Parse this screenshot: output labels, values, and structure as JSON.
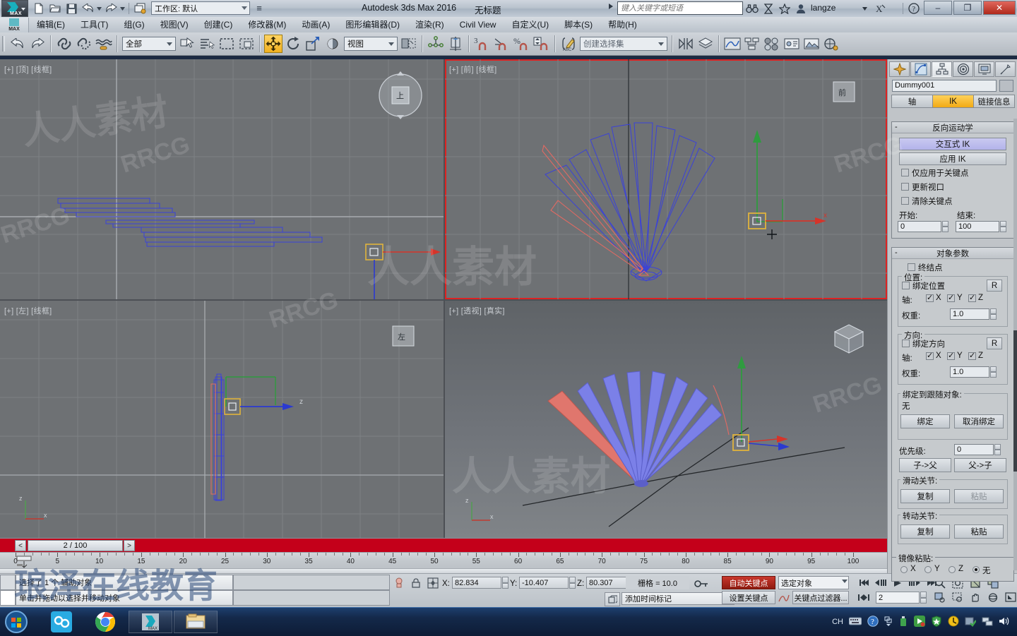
{
  "titlebar": {
    "app_title": "Autodesk 3ds Max 2016",
    "doc_title": "无标题",
    "workspace_label": "工作区: 默认",
    "search_placeholder": "键入关键字或短语",
    "user": "langze",
    "max_caption": "MAX",
    "minimize": "–",
    "restore": "❐",
    "close": "✕"
  },
  "menu": {
    "max_caption": "MAX",
    "items": [
      "编辑(E)",
      "工具(T)",
      "组(G)",
      "视图(V)",
      "创建(C)",
      "修改器(M)",
      "动画(A)",
      "图形编辑器(D)",
      "渲染(R)",
      "Civil View",
      "自定义(U)",
      "脚本(S)",
      "帮助(H)"
    ]
  },
  "toolbar": {
    "selection_filter": "全部",
    "ref_coord_system": "视图",
    "named_selection_sets": "创建选择集",
    "icons": [
      "undo-icon",
      "redo-icon",
      "select-link-icon",
      "unlink-icon",
      "bind-spacewarp-icon",
      "select-object-icon",
      "select-by-name-icon",
      "rect-select-region-icon",
      "window-crossing-icon",
      "select-and-move-icon",
      "select-and-rotate-icon",
      "select-and-scale-icon",
      "snap-toggle-icon",
      "angle-snap-icon",
      "percent-snap-icon",
      "spinner-snap-icon",
      "mirror-icon",
      "align-icon",
      "layer-manager-icon",
      "curve-editor-icon",
      "schematic-view-icon",
      "material-editor-icon",
      "render-setup-icon",
      "render-frame-icon",
      "render-production-icon"
    ]
  },
  "viewports": [
    {
      "id": "top",
      "label": "[+] [顶] [线框]"
    },
    {
      "id": "front",
      "label": "[+] [前] [线框]",
      "active": true
    },
    {
      "id": "left",
      "label": "[+] [左] [线框]"
    },
    {
      "id": "persp",
      "label": "[+] [透视] [真实]"
    }
  ],
  "viewcube": {
    "top": "上",
    "front": "前",
    "left": "左"
  },
  "axis_tripod": {
    "x": "x",
    "y": "y",
    "z": "z"
  },
  "timeslider": {
    "current": "2 / 100",
    "prev": "<",
    "next": ">"
  },
  "trackbar": {
    "ticks": [
      0,
      5,
      10,
      15,
      20,
      25,
      30,
      35,
      40,
      45,
      50,
      55,
      60,
      65,
      70,
      75,
      80,
      85,
      90,
      95,
      100
    ]
  },
  "statusbar": {
    "prompt_selection": "选择了 1 个 辅助对象",
    "prompt_hint": "单击并拖动以选择并移动对象",
    "isolate_icon": "isolate-selection-icon",
    "lock_icon": "selection-lock-icon",
    "coords": {
      "x_label": "X:",
      "x": "82.834",
      "y_label": "Y:",
      "y": "-10.407",
      "z_label": "Z:",
      "z": "80.307"
    },
    "grid": "栅格 = 10.0",
    "add_time_tag": "添加时间标记",
    "key_mode_icon": "key-mode-icon"
  },
  "animation": {
    "auto_key": "自动关键点",
    "set_key": "设置关键点",
    "key_filters": "关键点过滤器...",
    "selection_list": "选定对象",
    "curve_icon": "set-key-curve-icon",
    "current_frame": "2",
    "transport": [
      "go-to-start-icon",
      "previous-frame-icon",
      "play-animation-icon",
      "next-frame-icon",
      "go-to-end-icon"
    ],
    "key_mode_toggle": "key-mode-toggle-icon",
    "nav_icons": [
      "zoom-icon",
      "zoom-all-icon",
      "zoom-extents-icon",
      "zoom-extents-all-icon",
      "zoom-region-icon",
      "field-of-view-icon",
      "pan-view-icon",
      "orbit-icon",
      "maximize-viewport-icon"
    ]
  },
  "command_panel": {
    "tabs": [
      "create-tab-icon",
      "modify-tab-icon",
      "hierarchy-tab-icon",
      "motion-tab-icon",
      "display-tab-icon",
      "utilities-tab-icon"
    ],
    "selected_tab_index": 2,
    "object_name": "Dummy001",
    "sub_tabs": [
      "轴",
      "IK",
      "链接信息"
    ],
    "selected_sub_tab": "IK",
    "rollout_ik": {
      "title": "反向运动学",
      "minus": "-",
      "interactive_ik": "交互式 IK",
      "apply_ik": "应用 IK",
      "checkboxes": [
        {
          "label": "仅应用于关键点",
          "checked": false
        },
        {
          "label": "更新视口",
          "checked": false
        },
        {
          "label": "清除关键点",
          "checked": false
        }
      ],
      "start_label": "开始:",
      "start_value": "0",
      "end_label": "结束:",
      "end_value": "100"
    },
    "rollout_object_params": {
      "title": "对象参数",
      "minus": "-",
      "terminator": {
        "label": "终结点",
        "checked": false
      },
      "position_group": {
        "title": "位置:",
        "bind_label": "绑定位置",
        "bind_checked": false,
        "reset": "R",
        "axis_label": "轴:",
        "axes": [
          {
            "name": "X",
            "checked": true
          },
          {
            "name": "Y",
            "checked": true
          },
          {
            "name": "Z",
            "checked": true
          }
        ],
        "weight_label": "权重:",
        "weight": "1.0"
      },
      "orientation_group": {
        "title": "方向:",
        "bind_label": "绑定方向",
        "bind_checked": false,
        "reset": "R",
        "axis_label": "轴:",
        "axes": [
          {
            "name": "X",
            "checked": true
          },
          {
            "name": "Y",
            "checked": true
          },
          {
            "name": "Z",
            "checked": true
          }
        ],
        "weight_label": "权重:",
        "weight": "1.0"
      },
      "bind_to_follow": {
        "title": "绑定到跟随对象:",
        "value": "无",
        "bind": "绑定",
        "unbind": "取消绑定"
      },
      "precedence_label": "优先级:",
      "precedence_value": "0",
      "child_to_parent": "子->父",
      "parent_to_child": "父->子",
      "sliding_joints": {
        "title": "滑动关节:",
        "copy": "复制",
        "paste": "粘贴",
        "paste_disabled": true
      },
      "rotational_joints": {
        "title": "转动关节:",
        "copy": "复制",
        "paste": "粘贴",
        "paste_disabled": false
      },
      "mirror_paste": {
        "title": "镜像粘贴:",
        "options": [
          {
            "name": "X",
            "selected": false
          },
          {
            "name": "Y",
            "selected": false
          },
          {
            "name": "Z",
            "selected": false
          },
          {
            "name": "无",
            "selected": true
          }
        ]
      }
    }
  },
  "taskbar": {
    "items": [
      "start-orb-icon",
      "app-blue-icon",
      "chrome-icon",
      "3dsmax-icon",
      "explorer-icon"
    ],
    "tray": {
      "ime": "CH",
      "icons": [
        "keyboard-icon",
        "help-icon",
        "show-hidden-icon",
        "usb-icon",
        "app-green-icon",
        "shield-icon",
        "update-icon",
        "check-icon",
        "network-icon",
        "volume-icon"
      ]
    }
  },
  "watermarks": [
    "人人素材",
    "RRCG",
    "琅泽在线教育"
  ],
  "colors": {
    "accent_red": "#c4001a",
    "accent_yellow": "#f2aa15",
    "panel_bg": "#c0c4c8",
    "viewport_bg": "#6e7174",
    "wire_blue": "#3b42d8",
    "wire_red": "#e06a63"
  }
}
